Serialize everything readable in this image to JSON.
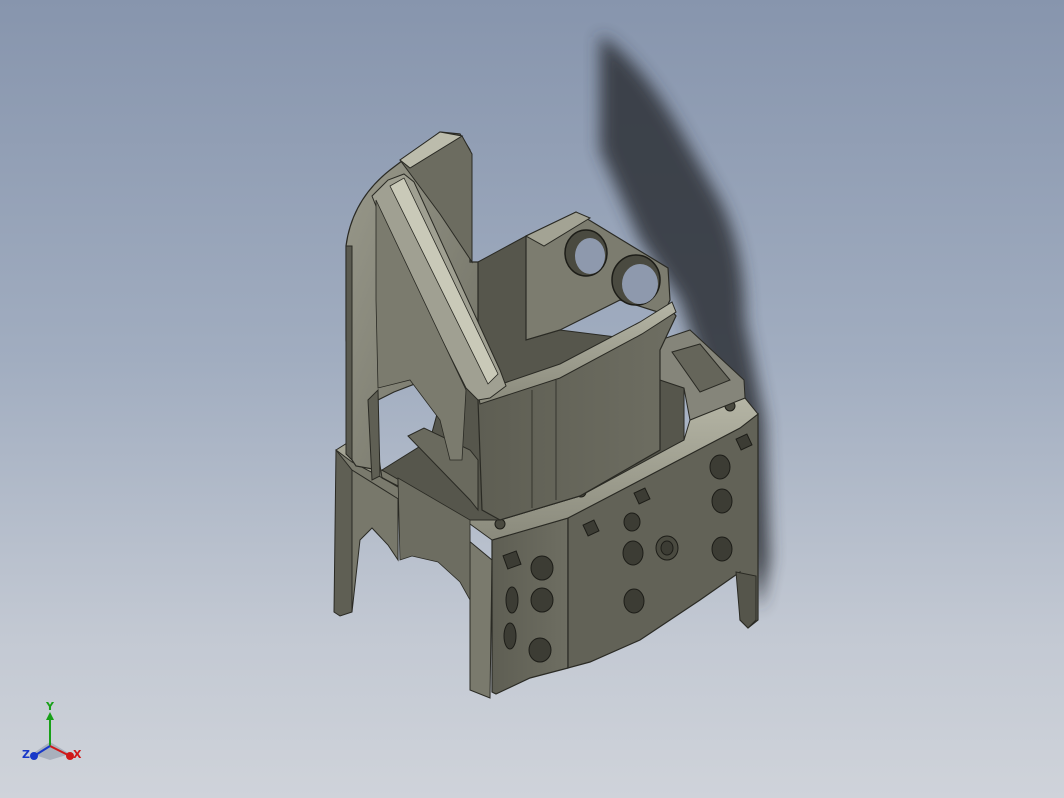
{
  "viewport": {
    "background_top": "#8795ad",
    "background_bottom": "#cfd3da"
  },
  "model": {
    "body_color": "#6f6f63",
    "face_light": "#8c8c7f",
    "face_dark": "#5d5d52",
    "edge_color": "#2a2a24",
    "shadow_color": "#2e3238"
  },
  "triad": {
    "x_label": "X",
    "y_label": "Y",
    "z_label": "Z",
    "x_color": "#d01818",
    "y_color": "#18a018",
    "z_color": "#1838c8"
  }
}
